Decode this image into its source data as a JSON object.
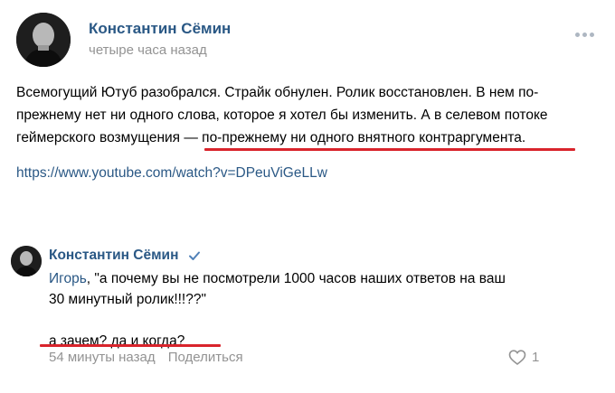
{
  "post": {
    "author": "Константин Сёмин",
    "time": "четыре часа назад",
    "text_lines": [
      "Всемогущий Ютуб разобрался. Страйк обнулен. Ролик восстановлен. В нем по-",
      "прежнему нет ни одного слова, которое я хотел бы изменить. А в селевом потоке",
      "геймерского возмущения — по-прежнему ни одного внятного контраргумента."
    ],
    "link": "https://www.youtube.com/watch?v=DPeuViGeLLw"
  },
  "comment": {
    "author": "Константин Сёмин",
    "addressee": "Игорь",
    "quote_line1": ", \"а почему вы не посмотрели 1000 часов наших ответов на ваш",
    "quote_line2": "30 минутный ролик!!!??\"",
    "reply": "а зачем? да и когда?",
    "time": "54 минуты назад",
    "share_label": "Поделиться",
    "likes": "1"
  },
  "colors": {
    "link": "#2a5885",
    "meta": "#939393",
    "annotation": "#d9242c"
  },
  "icons": [
    "more-icon",
    "verified-icon",
    "heart-icon"
  ]
}
